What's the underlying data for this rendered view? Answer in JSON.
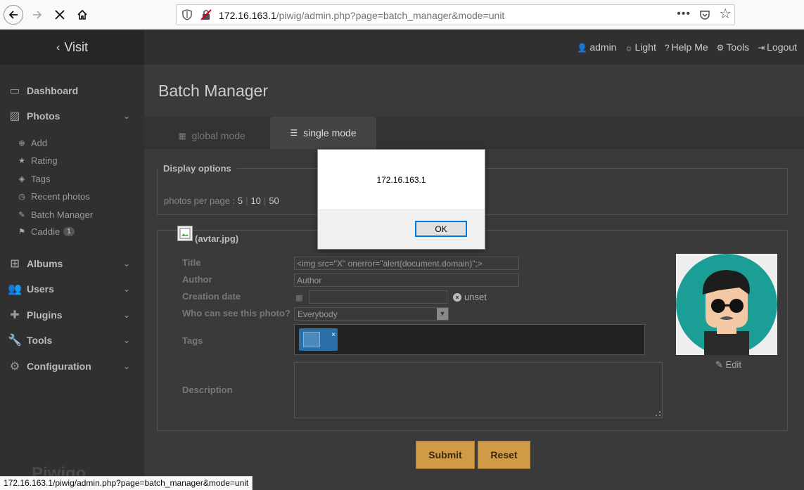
{
  "browser": {
    "url_host": "172.16.163.1",
    "url_path": "/piwig/admin.php?page=batch_manager&mode=unit",
    "status_url": "172.16.163.1/piwig/admin.php?page=batch_manager&mode=unit"
  },
  "header": {
    "visit_label": "Visit",
    "links": [
      {
        "icon": "user-icon",
        "label": "admin"
      },
      {
        "icon": "sun-icon",
        "label": "Light"
      },
      {
        "icon": "help-icon",
        "label": "Help Me"
      },
      {
        "icon": "cogs-icon",
        "label": "Tools"
      },
      {
        "icon": "logout-icon",
        "label": "Logout"
      }
    ]
  },
  "sidebar": {
    "dashboard": "Dashboard",
    "photos": "Photos",
    "photo_items": [
      {
        "icon": "plus-circle-icon",
        "label": "Add"
      },
      {
        "icon": "star-icon",
        "label": "Rating"
      },
      {
        "icon": "tags-icon",
        "label": "Tags"
      },
      {
        "icon": "clock-icon",
        "label": "Recent photos"
      },
      {
        "icon": "pencil-icon",
        "label": "Batch Manager"
      },
      {
        "icon": "flag-icon",
        "label": "Caddie",
        "badge": "1"
      }
    ],
    "albums": "Albums",
    "users": "Users",
    "plugins": "Plugins",
    "tools": "Tools",
    "configuration": "Configuration",
    "logo": "Piwigo"
  },
  "main": {
    "title": "Batch Manager",
    "tab_global": "global mode",
    "tab_single": "single mode",
    "display_options": "Display options",
    "ppp_label": "photos per page :",
    "ppp_options": [
      "5",
      "10",
      "50"
    ],
    "file_name": "(avtar.jpg)",
    "fields": {
      "title_label": "Title",
      "title_value": "<img src=\"X\" onerror=\"alert(document.domain)\";>",
      "author_label": "Author",
      "author_value": "Author",
      "date_label": "Creation date",
      "date_value": "",
      "unset_label": "unset",
      "who_label": "Who can see this photo?",
      "who_value": "Everybody",
      "tags_label": "Tags",
      "description_label": "Description"
    },
    "edit_label": "Edit",
    "submit_label": "Submit",
    "reset_label": "Reset"
  },
  "alert": {
    "message": "172.16.163.1",
    "ok_label": "OK"
  }
}
